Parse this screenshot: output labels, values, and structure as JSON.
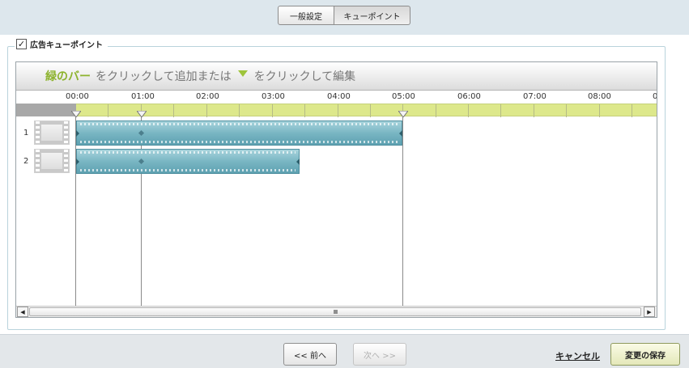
{
  "tabs": [
    {
      "label": "一般設定"
    },
    {
      "label": "キューポイント"
    }
  ],
  "section": {
    "checked": true,
    "legend": "広告キューポイント"
  },
  "editor": {
    "instruction_green": "緑のバー",
    "instruction_text1": "をクリックして追加または",
    "instruction_text2": "をクリックして編集",
    "ruler_ticks": [
      "00:00",
      "01:00",
      "02:00",
      "03:00",
      "04:00",
      "05:00",
      "06:00",
      "07:00",
      "08:00",
      "0"
    ],
    "rows": [
      {
        "number": "1"
      },
      {
        "number": "2"
      }
    ],
    "scroll_grip": "IIIII"
  },
  "footer": {
    "prev_label": "<< 前へ",
    "next_label": "次へ >>",
    "cancel_label": "キャンセル",
    "save_label": "変更の保存"
  },
  "colors": {
    "accent_green": "#9ec43b",
    "clip_teal": "#79b6c3",
    "cue_strip": "#dde88b"
  }
}
